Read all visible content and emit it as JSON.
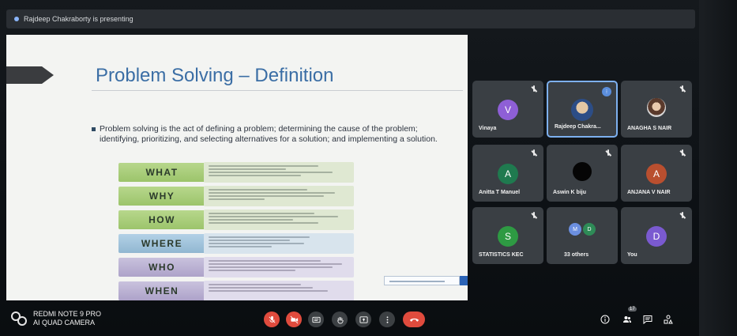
{
  "presenting": {
    "text": "Rajdeep Chakraborty is presenting"
  },
  "slide": {
    "title": "Problem Solving – Definition",
    "bullet": "Problem solving is the act of defining a problem; determining the cause of the problem; identifying, prioritizing, and selecting alternatives for a solution; and implementing a solution.",
    "rows": [
      {
        "label": "WHAT",
        "color": "green"
      },
      {
        "label": "WHY",
        "color": "green"
      },
      {
        "label": "HOW",
        "color": "green"
      },
      {
        "label": "WHERE",
        "color": "blue"
      },
      {
        "label": "WHO",
        "color": "purple"
      },
      {
        "label": "WHEN",
        "color": "purple"
      }
    ]
  },
  "participants": [
    {
      "name": "Vinaya",
      "initial": "V",
      "avatar_color": "#8e5fd6",
      "muted": true
    },
    {
      "name": "Rajdeep Chakra...",
      "initial": "",
      "avatar_type": "photo",
      "muted": false,
      "active": true
    },
    {
      "name": "ANAGHA S NAIR",
      "initial": "",
      "avatar_type": "girl",
      "muted": true
    },
    {
      "name": "Anitta T Manuel",
      "initial": "A",
      "avatar_color": "#1f7a4f",
      "muted": true
    },
    {
      "name": "Aswin K biju",
      "initial": "",
      "avatar_type": "black",
      "muted": true
    },
    {
      "name": "ANJANA V NAIR",
      "initial": "A",
      "avatar_color": "#b94f2f",
      "muted": true
    },
    {
      "name": "STATISTICS KEC",
      "initial": "S",
      "avatar_color": "#2e9a43",
      "muted": true
    },
    {
      "name": "33 others",
      "mini": [
        "M",
        "D"
      ],
      "mini_colors": [
        "#6b8fe0",
        "#2e8b57"
      ]
    },
    {
      "name": "You",
      "initial": "D",
      "avatar_color": "#7a5ad0",
      "muted": true
    }
  ],
  "watermark": {
    "line1": "REDMI NOTE 9 PRO",
    "line2": "AI QUAD CAMERA"
  },
  "controls": {
    "badge": "17",
    "icons": [
      "mic-off-icon",
      "camera-off-icon",
      "captions-icon",
      "raise-hand-icon",
      "present-icon",
      "more-icon",
      "end-call-icon"
    ],
    "right_icons": [
      "info-icon",
      "people-icon",
      "chat-icon",
      "activities-icon"
    ]
  },
  "colors": {
    "accent": "#7db0ef",
    "danger": "#e04b3d",
    "tile_bg": "#3a3f44",
    "title_blue": "#3b6ea5"
  }
}
